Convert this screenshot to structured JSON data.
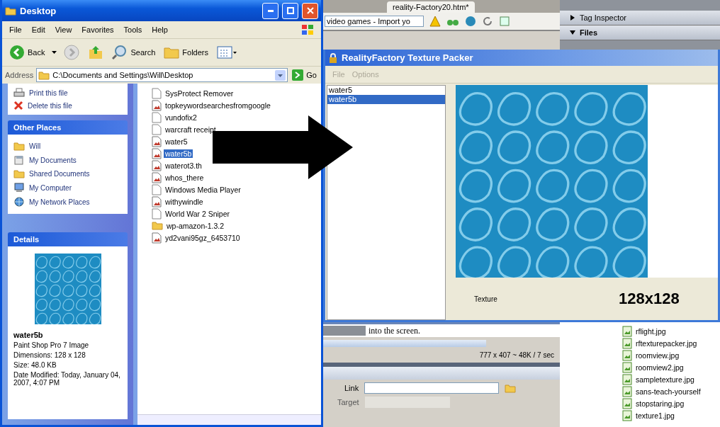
{
  "explorer": {
    "title": "Desktop",
    "menu": [
      "File",
      "Edit",
      "View",
      "Favorites",
      "Tools",
      "Help"
    ],
    "toolbar": {
      "back": "Back",
      "search": "Search",
      "folders": "Folders"
    },
    "address": {
      "label": "Address",
      "value": "C:\\Documents and Settings\\Will\\Desktop",
      "go": "Go"
    },
    "file_tasks": [
      "Print this file",
      "Delete this file"
    ],
    "other_places": {
      "title": "Other Places",
      "items": [
        "Will",
        "My Documents",
        "Shared Documents",
        "My Computer",
        "My Network Places"
      ]
    },
    "details": {
      "title": "Details",
      "name": "water5b",
      "type": "Paint Shop Pro 7 Image",
      "dimensions": "Dimensions: 128 x 128",
      "size": "Size: 48.0 KB",
      "modified": "Date Modified: Today, January 04, 2007, 4:07 PM"
    },
    "files": [
      {
        "name": "SysProtect Remover",
        "selected": false
      },
      {
        "name": "topkeywordsearchesfromgoogle",
        "selected": false
      },
      {
        "name": "vundofix2",
        "selected": false
      },
      {
        "name": "warcraft receipt",
        "selected": false
      },
      {
        "name": "water5",
        "selected": false
      },
      {
        "name": "water5b",
        "selected": true
      },
      {
        "name": "waterot3.th",
        "selected": false
      },
      {
        "name": "whos_there",
        "selected": false
      },
      {
        "name": "Windows Media Player",
        "selected": false
      },
      {
        "name": "withywindle",
        "selected": false
      },
      {
        "name": "World War 2 Sniper",
        "selected": false
      },
      {
        "name": "wp-amazon-1.3.2",
        "selected": false
      },
      {
        "name": "yd2vani95gz_6453710",
        "selected": false
      }
    ]
  },
  "editor": {
    "tabs": [
      {
        "label": "reality-Factory20.htm*",
        "selected": true
      }
    ],
    "title_field": "video games - Import yo",
    "design_text": "into the screen.",
    "status": "777 x 407 ~ 48K / 7 sec",
    "link_label": "Link",
    "target_label": "Target"
  },
  "panels": {
    "groups": [
      {
        "label": "Tag Inspector",
        "expanded": false
      },
      {
        "label": "Files",
        "expanded": true
      }
    ],
    "site_files": [
      "rflight.jpg",
      "rftexturepacker.jpg",
      "roomview.jpg",
      "roomview2.jpg",
      "sampletexture.jpg",
      "sans-teach-yourself",
      "stopstaring.jpg",
      "texture1.jpg"
    ]
  },
  "packer": {
    "title": "RealityFactory Texture Packer",
    "menu": [
      {
        "label": "File",
        "disabled": true
      },
      {
        "label": "Options",
        "disabled": true
      }
    ],
    "textures": [
      {
        "name": "water5",
        "selected": false
      },
      {
        "name": "water5b",
        "selected": true
      }
    ],
    "texture_label": "Texture",
    "texture_size": "128x128"
  }
}
